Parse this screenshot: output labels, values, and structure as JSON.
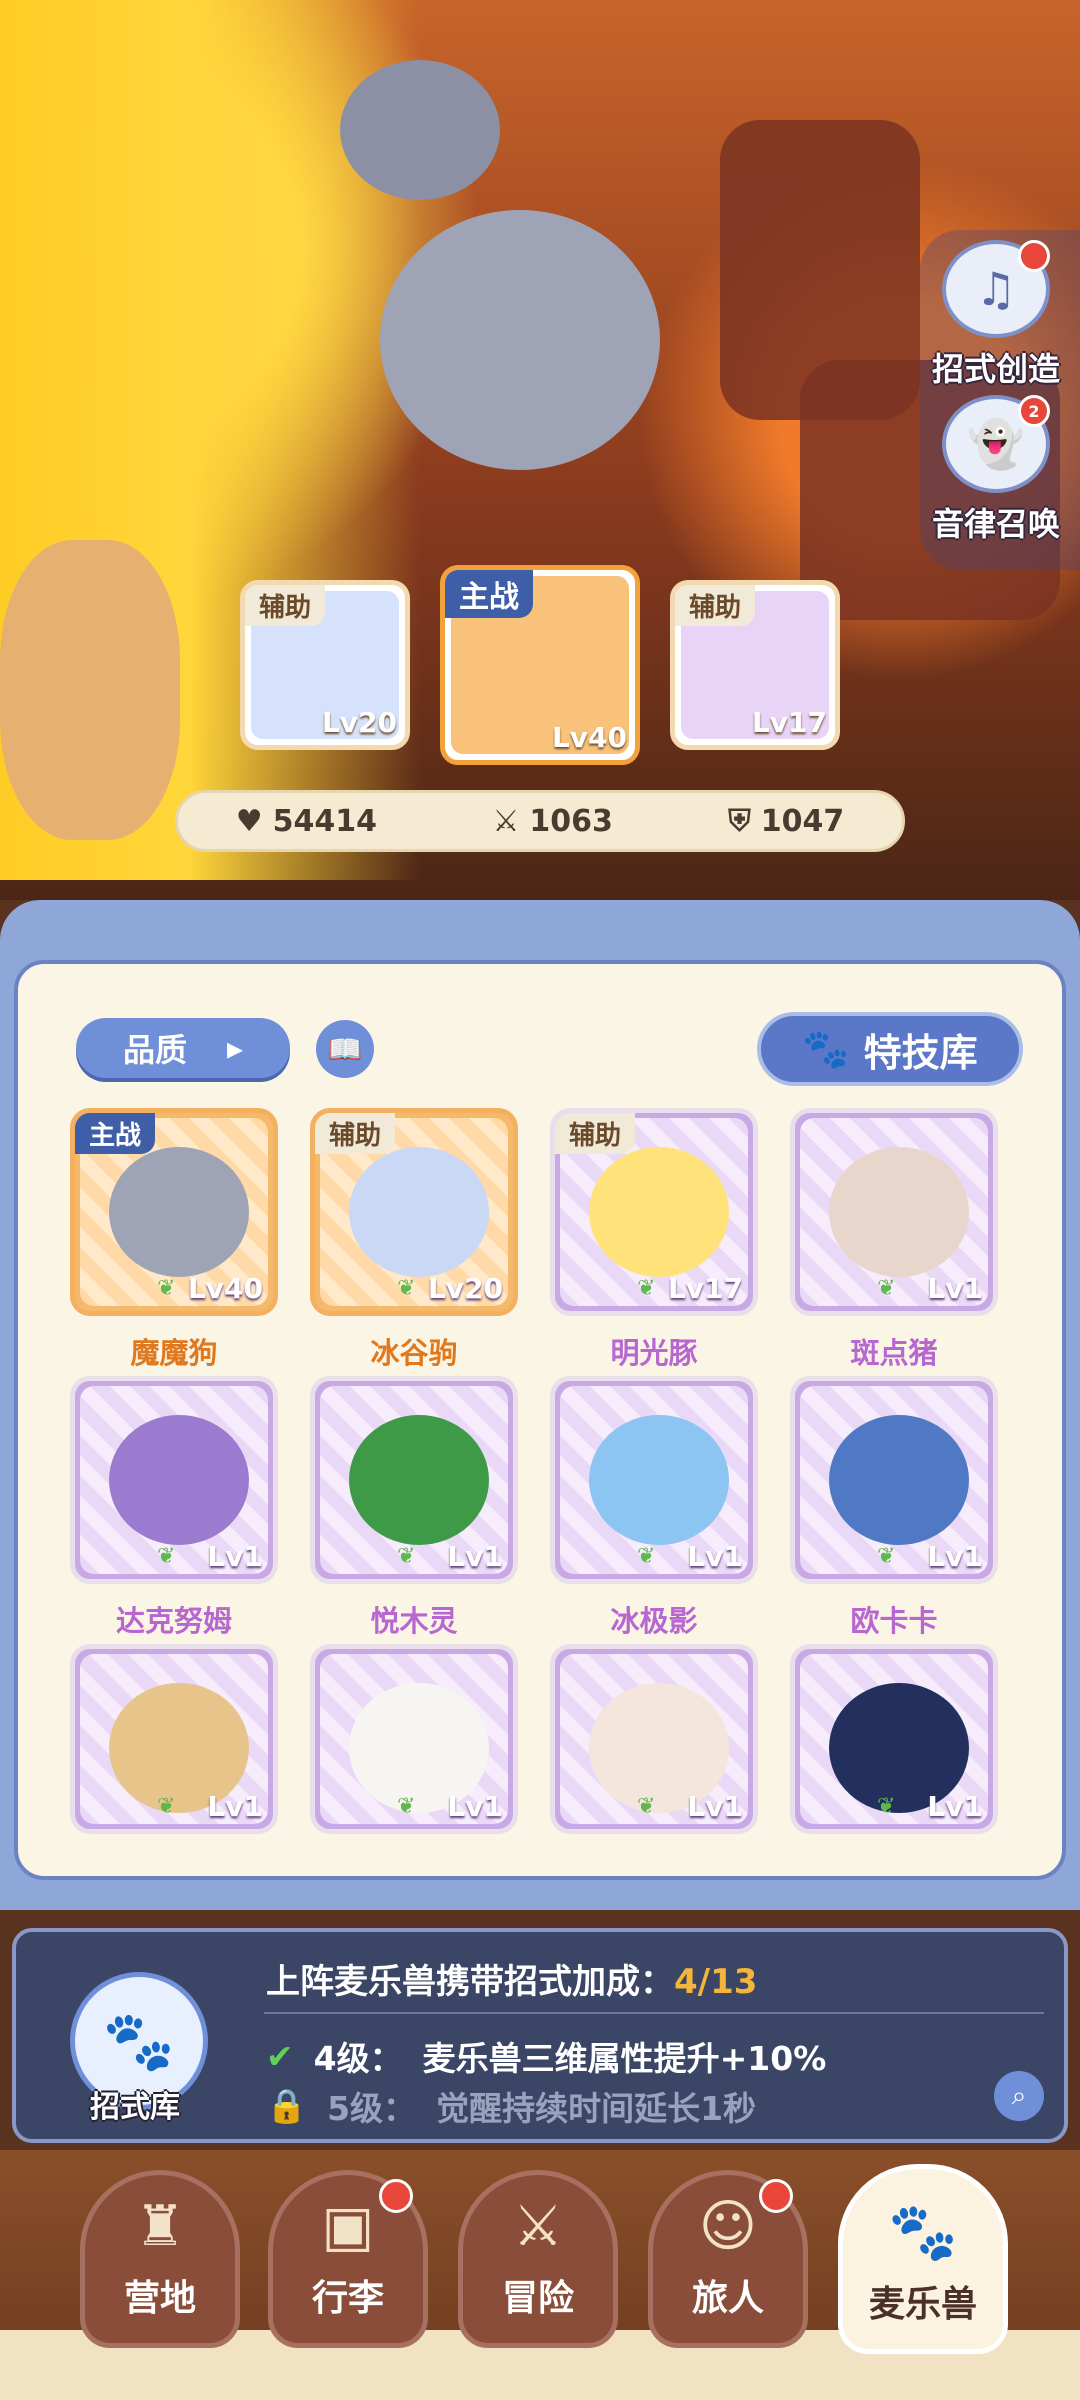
{
  "side_buttons": [
    {
      "label": "招式创造",
      "badge": ""
    },
    {
      "label": "音律召唤",
      "badge": "2"
    }
  ],
  "team": [
    {
      "tag": "辅助",
      "level": "Lv20"
    },
    {
      "tag": "主战",
      "level": "Lv40"
    },
    {
      "tag": "辅助",
      "level": "Lv17"
    }
  ],
  "stats": {
    "hp": "54414",
    "attack": "1063",
    "defense": "1047"
  },
  "filter": {
    "quality_label": "品质",
    "skill_library_label": "特技库"
  },
  "pets": [
    {
      "name": "魔魔狗",
      "level": "Lv40",
      "tag": "主战",
      "frame": "orange",
      "color": "#9fa3b6"
    },
    {
      "name": "冰谷驹",
      "level": "Lv20",
      "tag": "辅助",
      "frame": "orange",
      "color": "#c9d8f5"
    },
    {
      "name": "明光豚",
      "level": "Lv17",
      "tag": "辅助",
      "frame": "purple",
      "color": "#ffe27a"
    },
    {
      "name": "斑点猪",
      "level": "Lv1",
      "tag": "",
      "frame": "purple",
      "color": "#e8d6cc"
    },
    {
      "name": "达克努姆",
      "level": "Lv1",
      "tag": "",
      "frame": "purple",
      "color": "#9b7bd0"
    },
    {
      "name": "悦木灵",
      "level": "Lv1",
      "tag": "",
      "frame": "purple",
      "color": "#3f9a48"
    },
    {
      "name": "冰极影",
      "level": "Lv1",
      "tag": "",
      "frame": "purple",
      "color": "#8cc4f2"
    },
    {
      "name": "欧卡卡",
      "level": "Lv1",
      "tag": "",
      "frame": "purple",
      "color": "#4f79c4"
    },
    {
      "name": "",
      "level": "Lv1",
      "tag": "",
      "frame": "purple",
      "color": "#e6c48a"
    },
    {
      "name": "",
      "level": "Lv1",
      "tag": "",
      "frame": "purple",
      "color": "#f7f5f2"
    },
    {
      "name": "",
      "level": "Lv1",
      "tag": "",
      "frame": "purple",
      "color": "#f4e6dc"
    },
    {
      "name": "",
      "level": "Lv1",
      "tag": "",
      "frame": "purple",
      "color": "#23305e"
    }
  ],
  "bonus": {
    "icon_label": "招式库",
    "title": "上阵麦乐兽携带招式加成：",
    "count": "4/13",
    "row1_level": "4级：",
    "row1_text": "麦乐兽三维属性提升+10%",
    "row2_level": "5级：",
    "row2_text": "觉醒持续时间延长1秒"
  },
  "nav": [
    {
      "label": "营地",
      "icon": "castle-icon",
      "glyph": "♜",
      "dot": false,
      "active": false
    },
    {
      "label": "行李",
      "icon": "chest-icon",
      "glyph": "▣",
      "dot": true,
      "active": false
    },
    {
      "label": "冒险",
      "icon": "swords-icon",
      "glyph": "⚔",
      "dot": false,
      "active": false
    },
    {
      "label": "旅人",
      "icon": "traveler-icon",
      "glyph": "☺",
      "dot": true,
      "active": false
    },
    {
      "label": "麦乐兽",
      "icon": "pet-icon",
      "glyph": "🐾",
      "dot": false,
      "active": true
    }
  ]
}
